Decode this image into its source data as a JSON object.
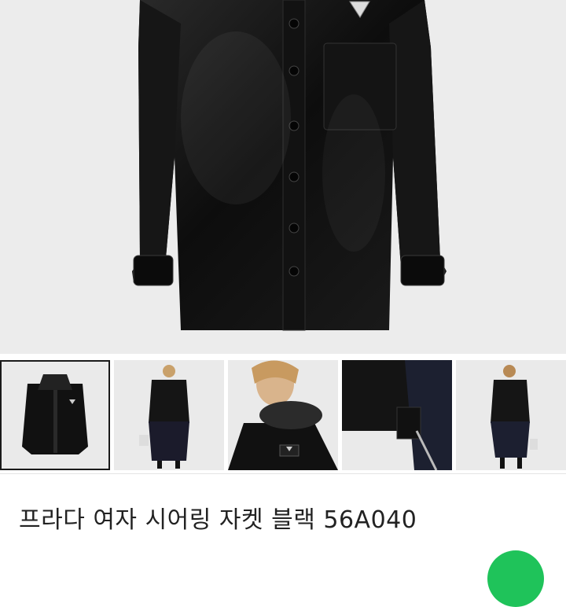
{
  "product": {
    "title": "프라다 여자 시어링 자켓 블랙 56A040"
  },
  "gallery": {
    "selected_index": 0,
    "thumbnail_count": 5
  },
  "colors": {
    "hero_background": "#ececec",
    "jacket": "#111111",
    "fab": "#1fc35a"
  }
}
